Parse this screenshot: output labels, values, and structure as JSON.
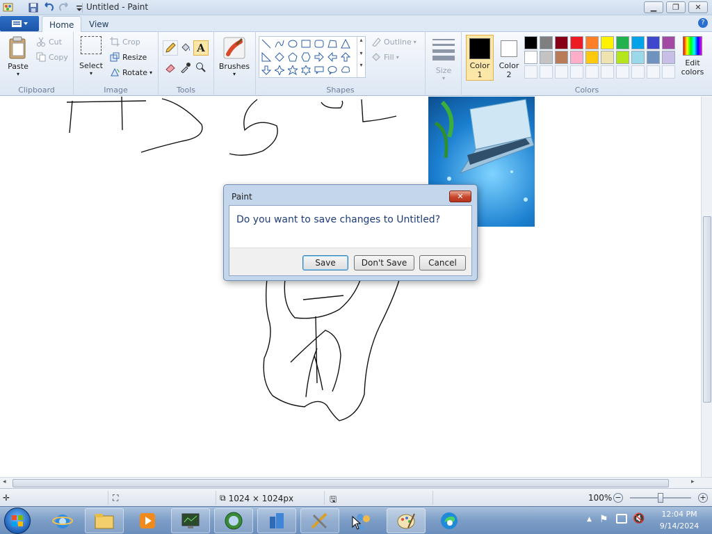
{
  "window": {
    "title": "Untitled - Paint"
  },
  "tabs": {
    "home": "Home",
    "view": "View"
  },
  "ribbon": {
    "clipboard": {
      "label": "Clipboard",
      "paste": "Paste",
      "cut": "Cut",
      "copy": "Copy"
    },
    "image": {
      "label": "Image",
      "select": "Select",
      "crop": "Crop",
      "resize": "Resize",
      "rotate": "Rotate"
    },
    "tools": {
      "label": "Tools"
    },
    "brushes": "Brushes",
    "shapes": {
      "label": "Shapes",
      "outline": "Outline",
      "fill": "Fill"
    },
    "size": "Size",
    "colors": {
      "label": "Colors",
      "color1": "Color",
      "color1_num": "1",
      "color2": "Color",
      "color2_num": "2",
      "edit": "Edit",
      "edit2": "colors",
      "color1_value": "#000000",
      "color2_value": "#ffffff",
      "palette_row1": [
        "#000000",
        "#7f7f7f",
        "#880015",
        "#ed1c24",
        "#ff7f27",
        "#fff200",
        "#22b14c",
        "#00a2e8",
        "#3f48cc",
        "#a349a4"
      ],
      "palette_row2": [
        "#ffffff",
        "#c3c3c3",
        "#b97a57",
        "#ffaec9",
        "#ffc90e",
        "#efe4b0",
        "#b5e61d",
        "#99d9ea",
        "#7092be",
        "#c8bfe7"
      ]
    }
  },
  "statusbar": {
    "dimensions": "1024 × 1024px",
    "zoom": "100%"
  },
  "taskbar": {
    "time": "12:04 PM",
    "date": "9/14/2024"
  },
  "dialog": {
    "title": "Paint",
    "message": "Do you want to save changes to Untitled?",
    "save": "Save",
    "dont_save": "Don't Save",
    "cancel": "Cancel"
  }
}
